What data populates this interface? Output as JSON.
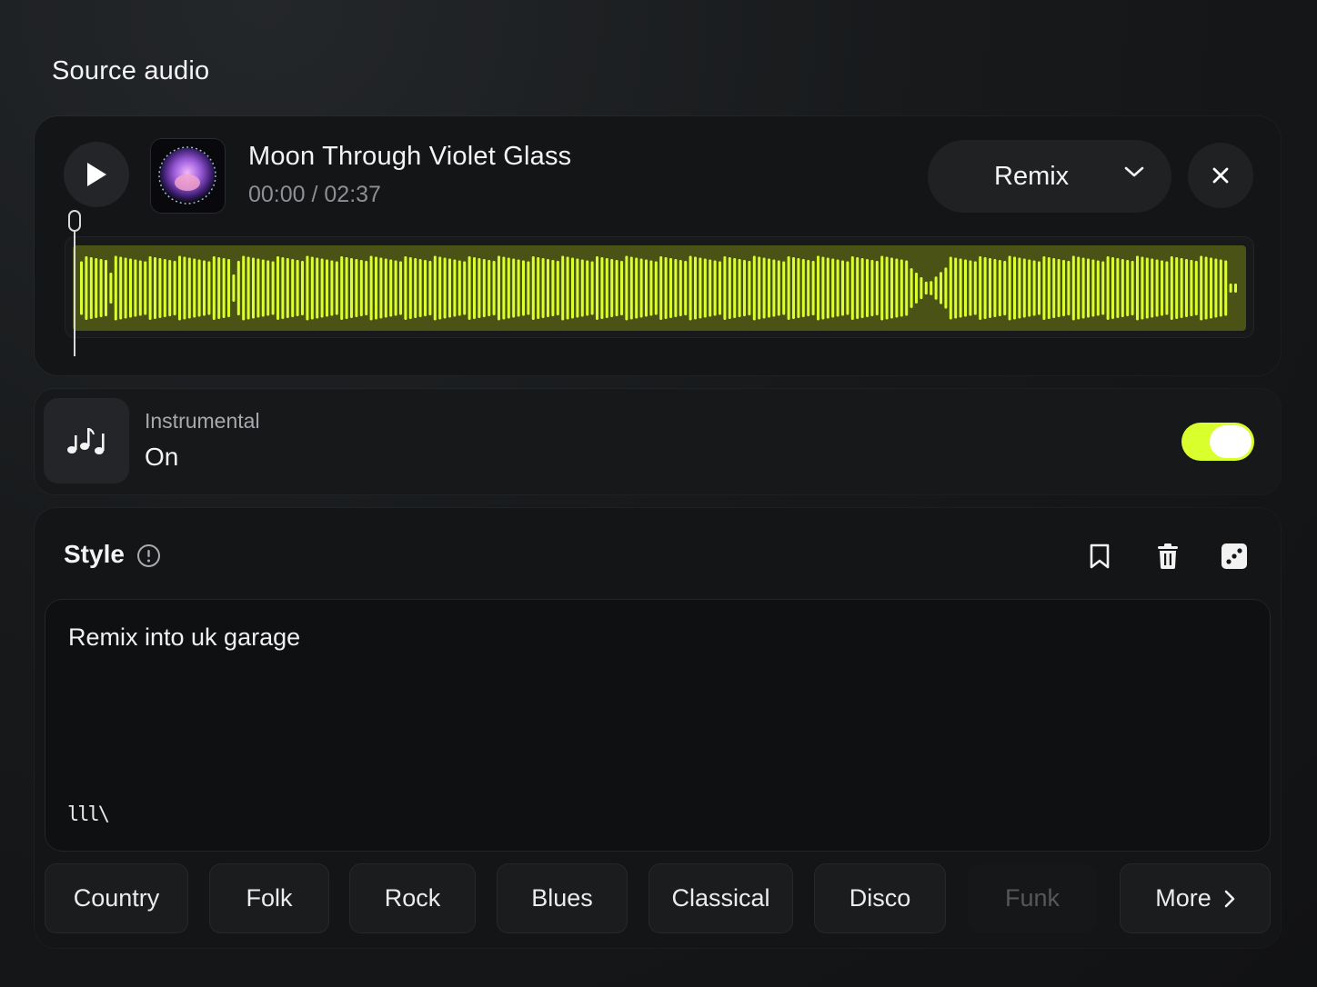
{
  "header": {
    "title": "Source audio"
  },
  "track": {
    "title": "Moon Through Violet Glass",
    "time": "00:00 / 02:37",
    "progress": 0
  },
  "mode": {
    "selected": "Remix"
  },
  "instrumental": {
    "label": "Instrumental",
    "value": "On",
    "enabled": true
  },
  "style": {
    "title": "Style",
    "prompt": "Remix into uk garage",
    "mark": "lll\\"
  },
  "genres": [
    "Country",
    "Folk",
    "Rock",
    "Blues",
    "Classical",
    "Disco",
    "Funk"
  ],
  "more_label": "More",
  "colors": {
    "accent": "#d9ff2d",
    "wave_bg": "#4a5216"
  },
  "icons": [
    "play-icon",
    "chevron-down-icon",
    "close-icon",
    "music-notes-icon",
    "info-icon",
    "bookmark-icon",
    "trash-icon",
    "dice-icon",
    "chevron-right-icon"
  ]
}
